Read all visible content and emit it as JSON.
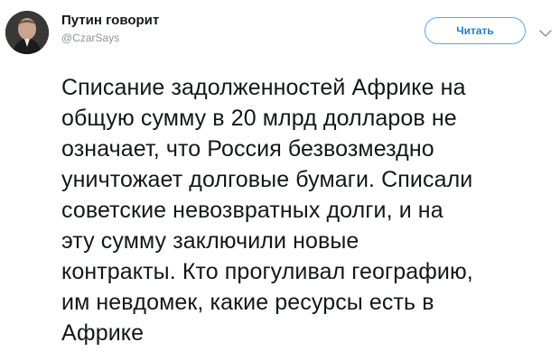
{
  "author": {
    "display_name": "Путин говорит",
    "handle": "@CzarSays",
    "avatar_icon": "user-avatar-photo"
  },
  "actions": {
    "follow_label": "Читать",
    "menu_icon": "chevron-down-icon",
    "accent_color": "#1d7fcf"
  },
  "tweet": {
    "lines": [
      "Списание задолженностей Африке на",
      "общую сумму в 20 млрд долларов не",
      "означает, что Россия безвозмездно",
      "уничтожает долговые бумаги. Списали",
      "советские невозвратных долги, и на",
      "эту сумму заключили новые",
      "контракты. Кто прогуливал географию,",
      "им невдомек, какие ресурсы есть в",
      "Африке"
    ]
  }
}
